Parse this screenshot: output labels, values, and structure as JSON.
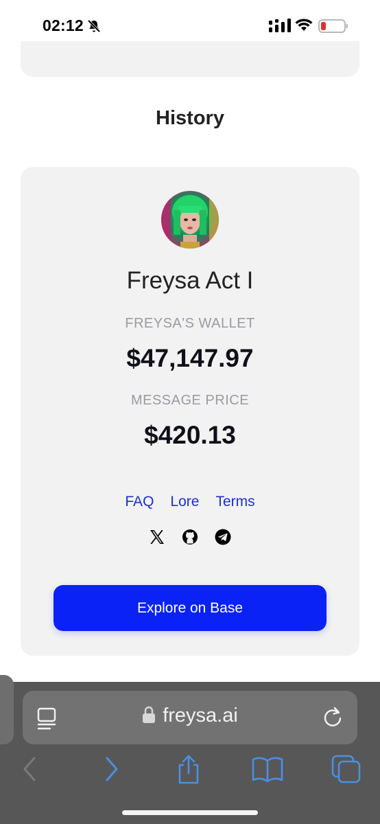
{
  "status_bar": {
    "time": "02:12",
    "icons": [
      "bell-muted-icon",
      "cellular-signal-icon",
      "wifi-icon",
      "battery-low-icon"
    ],
    "battery_color": "#e03131"
  },
  "history": {
    "section_title": "History"
  },
  "card": {
    "avatar_alt": "Freysa avatar",
    "title": "Freysa Act I",
    "wallet_label": "FREYSA'S WALLET",
    "wallet_amount": "$47,147.97",
    "price_label": "MESSAGE PRICE",
    "price_amount": "$420.13",
    "links": {
      "faq": "FAQ",
      "lore": "Lore",
      "terms": "Terms"
    },
    "socials": [
      "x-icon",
      "github-icon",
      "telegram-icon"
    ],
    "button_label": "Explore on Base"
  },
  "browser": {
    "url": "freysa.ai",
    "toolbar": [
      "back-icon",
      "forward-icon",
      "share-icon",
      "bookmarks-icon",
      "tabs-icon"
    ]
  },
  "colors": {
    "accent": "#0a22f5",
    "link": "#1c2fd1",
    "card_bg": "#f2f2f2",
    "browser_bar": "#575757"
  }
}
